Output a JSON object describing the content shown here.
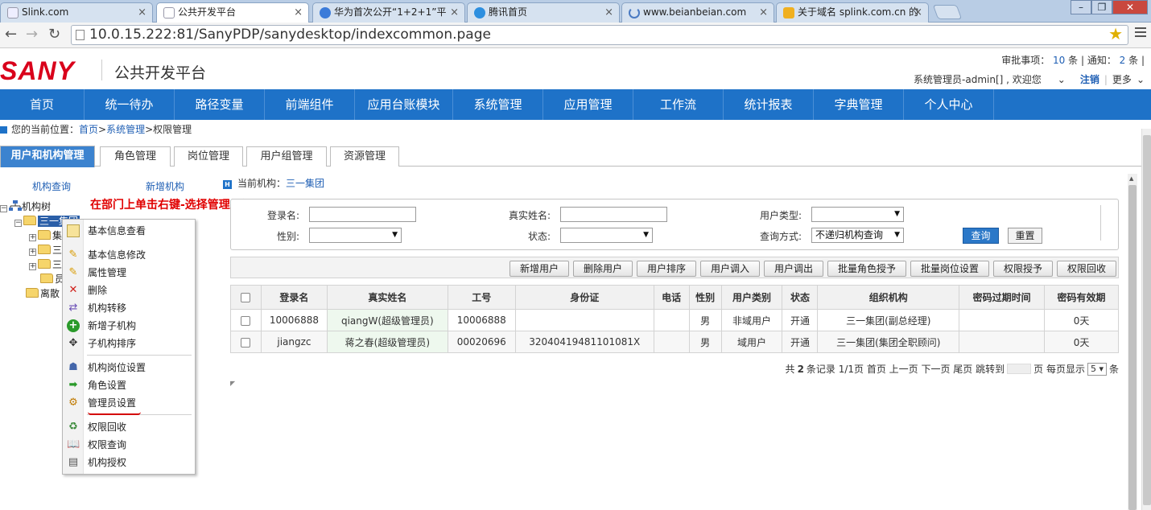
{
  "browser": {
    "tabs": [
      {
        "title": "Slink.com",
        "active": false
      },
      {
        "title": "公共开发平台",
        "active": true
      },
      {
        "title": "华为首次公开“1+2+1”平",
        "active": false
      },
      {
        "title": "腾讯首页",
        "active": false
      },
      {
        "title": "www.beianbeian.com",
        "active": false
      },
      {
        "title": "关于域名 splink.com.cn 的",
        "active": false
      }
    ],
    "url": "10.0.15.222:81/SanyPDP/sanydesktop/indexcommon.page"
  },
  "header": {
    "logo_text": "SANY",
    "app_title": "公共开发平台",
    "approvals_label": "审批事项：",
    "approvals_count": "10",
    "approvals_unit": "条 | 通知：",
    "notices_count": "2",
    "notices_unit": "条 |",
    "user_text": "系统管理员-admin[] , 欢迎您",
    "logout": "注销",
    "more": "更多"
  },
  "main_menu": [
    "首页",
    "统一待办",
    "路径变量",
    "前端组件",
    "应用台账模块",
    "系统管理",
    "应用管理",
    "工作流",
    "统计报表",
    "字典管理",
    "个人中心"
  ],
  "breadcrumb": {
    "prefix": "您的当前位置：",
    "home": "首页",
    "sep1": ">",
    "section": "系统管理",
    "sep2": ">",
    "current": "权限管理"
  },
  "subtabs": [
    "用户和机构管理",
    "角色管理",
    "岗位管理",
    "用户组管理",
    "资源管理"
  ],
  "tree": {
    "tab_query": "机构查询",
    "tab_new": "新增机构",
    "root": "机构树",
    "node_selected": "三一集团",
    "child_1": "集",
    "child_2": "三",
    "child_3": "三",
    "child_4": "员",
    "node_leave": "离散"
  },
  "annotation": "在部门上单击右键-选择管理员设置",
  "context_menu": {
    "group1": [
      "基本信息查看",
      "基本信息修改",
      "属性管理",
      "删除",
      "机构转移",
      "新增子机构",
      "子机构排序"
    ],
    "group2": [
      "机构岗位设置",
      "角色设置",
      "管理员设置"
    ],
    "group3": [
      "权限回收",
      "权限查询",
      "机构授权"
    ]
  },
  "current_org": {
    "label": "当前机构：",
    "value": "三一集团"
  },
  "search": {
    "login_label": "登录名:",
    "realname_label": "真实姓名:",
    "usertype_label": "用户类型:",
    "gender_label": "性别:",
    "status_label": "状态:",
    "querymode_label": "查询方式:",
    "querymode_value": "不递归机构查询",
    "query_btn": "查询",
    "reset_btn": "重置"
  },
  "toolbar": [
    "新增用户",
    "删除用户",
    "用户排序",
    "用户调入",
    "用户调出",
    "批量角色授予",
    "批量岗位设置",
    "权限授予",
    "权限回收"
  ],
  "table": {
    "headers": [
      "登录名",
      "真实姓名",
      "工号",
      "身份证",
      "电话",
      "性别",
      "用户类别",
      "状态",
      "组织机构",
      "密码过期时间",
      "密码有效期"
    ],
    "rows": [
      [
        "10006888",
        "qiangW(超级管理员)",
        "10006888",
        "",
        "",
        "男",
        "非域用户",
        "开通",
        "三一集团(副总经理)",
        "",
        "0天"
      ],
      [
        "jiangzc",
        "蒋之春(超级管理员)",
        "00020696",
        "32040419481101081X",
        "",
        "男",
        "域用户",
        "开通",
        "三一集团(集团全职顾问)",
        "",
        "0天"
      ]
    ]
  },
  "pager": {
    "prefix": "共",
    "total": "2",
    "text1": "条记录 1/1页 首页 上一页 下一页 尾页 跳转到",
    "text2": "页 每页显示",
    "page_size": "5",
    "suffix": "条"
  },
  "colors": {
    "brand_red": "#d9001b",
    "menu_blue": "#1e72c8",
    "link_blue": "#1f5fb4",
    "annotation_red": "#e00000"
  }
}
